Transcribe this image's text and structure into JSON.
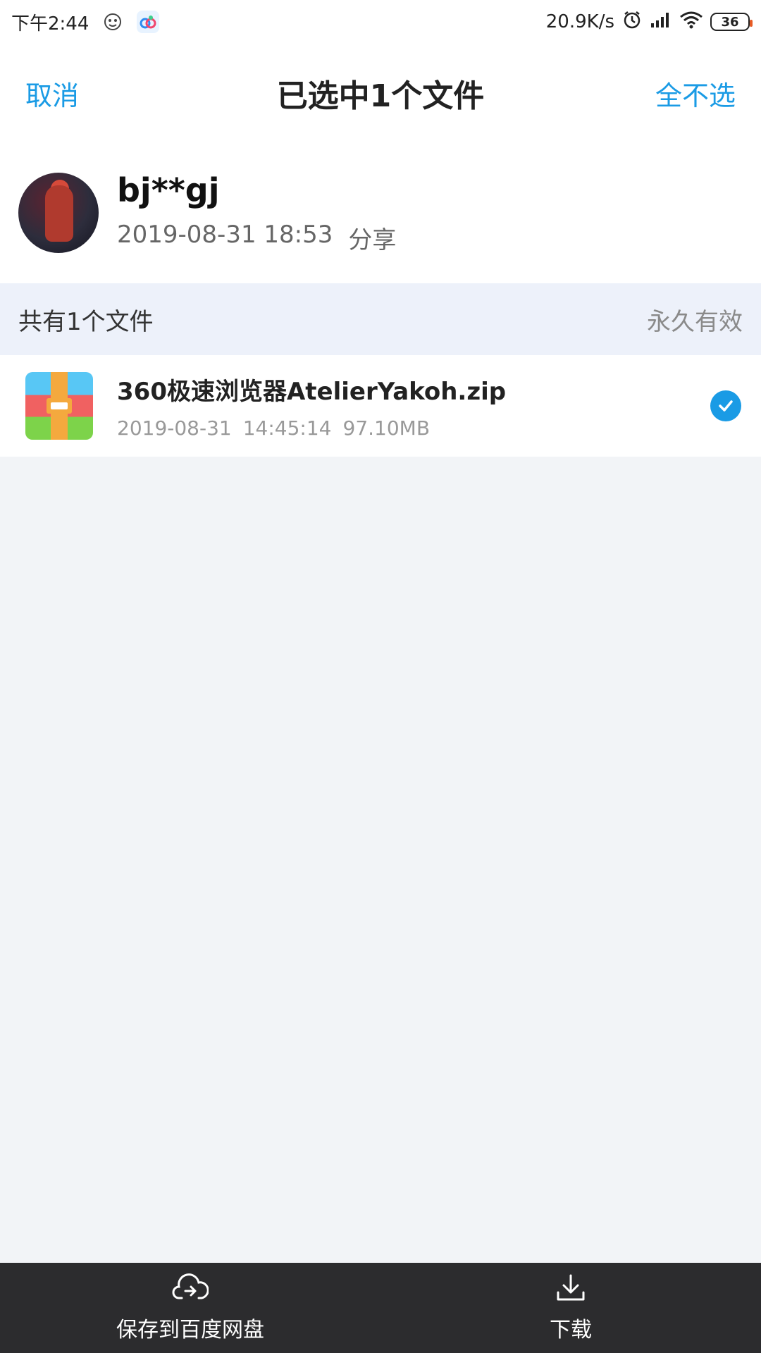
{
  "status_bar": {
    "time": "下午2:44",
    "network_speed": "20.9K/s",
    "battery_level": "36",
    "icons": [
      "face-app-icon",
      "baidu-app-icon",
      "alarm-icon",
      "signal-icon",
      "wifi-icon",
      "battery-icon"
    ]
  },
  "nav": {
    "cancel_label": "取消",
    "title": "已选中1个文件",
    "select_none_label": "全不选"
  },
  "sharer": {
    "name": "bj**gj",
    "timestamp": "2019-08-31 18:53",
    "action": "分享"
  },
  "summary": {
    "count_text": "共有1个文件",
    "validity": "永久有效"
  },
  "files": [
    {
      "name": "360极速浏览器AtelierYakoh.zip",
      "date": "2019-08-31",
      "time": "14:45:14",
      "size": "97.10MB",
      "selected": true
    }
  ],
  "bottom_bar": {
    "save_label": "保存到百度网盘",
    "download_label": "下载"
  },
  "colors": {
    "accent": "#1a9be5",
    "summary_bg": "#edf1fa",
    "page_bg": "#f2f4f7",
    "bottom_bar_bg": "#2c2c2e"
  }
}
